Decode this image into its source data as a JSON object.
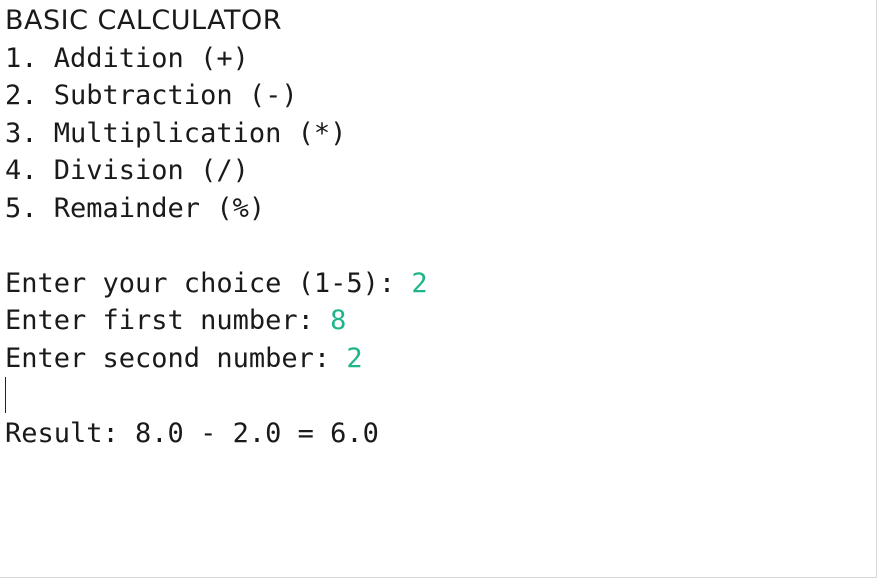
{
  "console": {
    "title": "BASIC CALCULATOR",
    "menu": [
      "1. Addition (+)",
      "2. Subtraction (-)",
      "3. Multiplication (*)",
      "4. Division (/)",
      "5. Remainder (%)"
    ],
    "prompts": [
      {
        "text": "Enter your choice (1-5): ",
        "value": "2"
      },
      {
        "text": "Enter first number: ",
        "value": "8"
      },
      {
        "text": "Enter second number: ",
        "value": "2"
      }
    ],
    "result": "Result: 8.0 - 2.0 = 6.0"
  },
  "colors": {
    "input": "#1fb58a",
    "text": "#1a1a1a",
    "background": "#ffffff"
  }
}
